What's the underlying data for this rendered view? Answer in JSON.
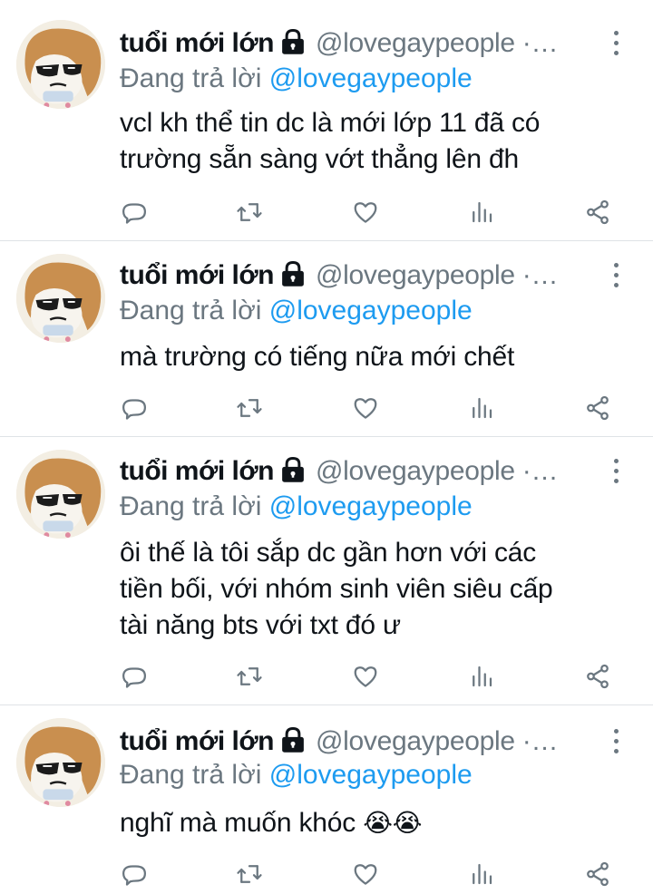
{
  "tweets": [
    {
      "display_name": "tuổi mới lớn",
      "handle": "@lovegaypeople ·…",
      "reply_prefix": "Đang trả lời ",
      "reply_to": "@lovegaypeople",
      "text": "vcl kh thể tin dc là mới lớp 11 đã có\ntrường sẵn sàng vớt thẳng lên đh"
    },
    {
      "display_name": "tuổi mới lớn",
      "handle": "@lovegaypeople ·…",
      "reply_prefix": "Đang trả lời ",
      "reply_to": "@lovegaypeople",
      "text": "mà trường có tiếng nữa mới chết"
    },
    {
      "display_name": "tuổi mới lớn",
      "handle": "@lovegaypeople ·…",
      "reply_prefix": "Đang trả lời ",
      "reply_to": "@lovegaypeople",
      "text": "ôi thế là tôi sắp dc gần hơn với các\ntiền bối, với nhóm sinh viên siêu cấp\ntài năng bts với txt đó ư"
    },
    {
      "display_name": "tuổi mới lớn",
      "handle": "@lovegaypeople ·…",
      "reply_prefix": "Đang trả lời ",
      "reply_to": "@lovegaypeople",
      "text": "nghĩ mà muốn khóc ",
      "emoji": "😭😭"
    }
  ],
  "icons": {
    "reply": "reply-icon",
    "retweet": "retweet-icon",
    "like": "heart-icon",
    "analytics": "analytics-icon",
    "share": "share-icon",
    "more": "more-icon",
    "lock": "lock-icon"
  },
  "colors": {
    "text": "#0f1419",
    "secondary": "#6b7780",
    "link": "#1d9bf0",
    "divider": "#dfe3e6"
  }
}
